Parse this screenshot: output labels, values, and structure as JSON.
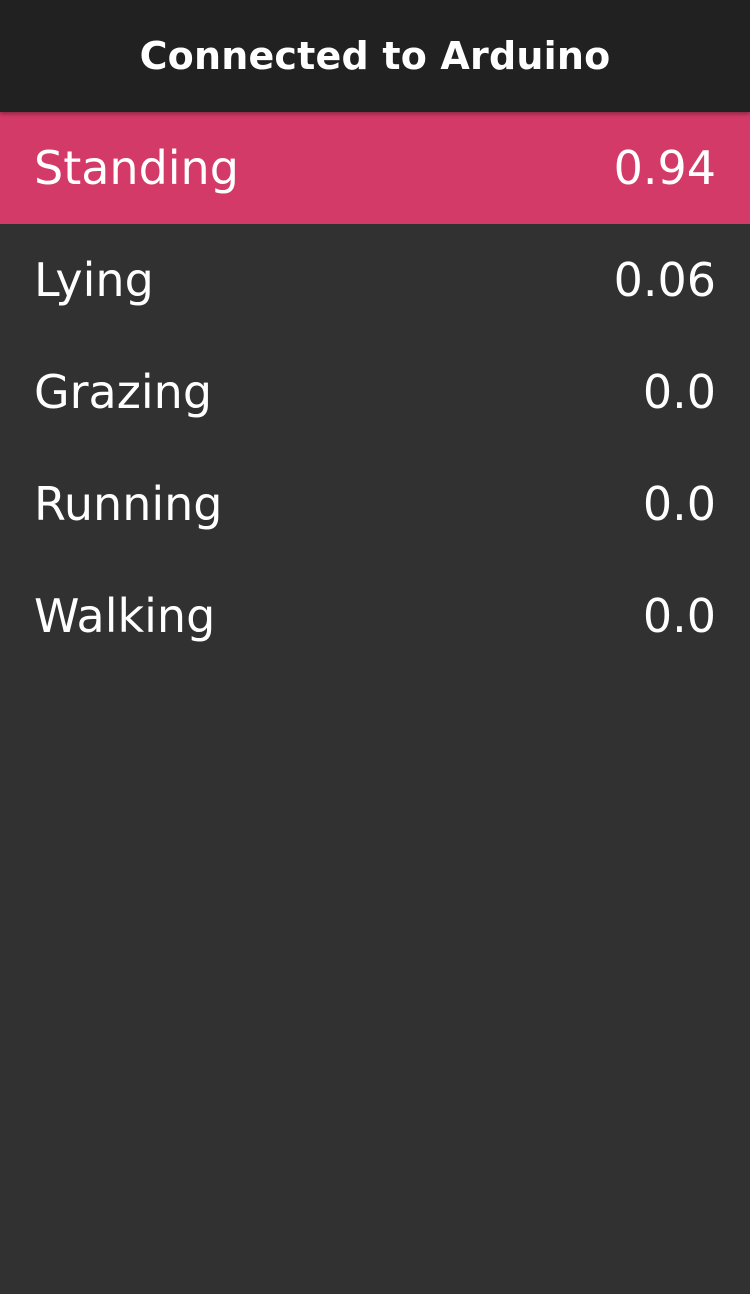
{
  "header": {
    "title": "Connected to Arduino"
  },
  "colors": {
    "header_bg": "#212121",
    "background": "#313131",
    "active_row": "#d43a67",
    "text": "#ffffff"
  },
  "activities": [
    {
      "label": "Standing",
      "value": "0.94",
      "active": true
    },
    {
      "label": "Lying",
      "value": "0.06",
      "active": false
    },
    {
      "label": "Grazing",
      "value": "0.0",
      "active": false
    },
    {
      "label": "Running",
      "value": "0.0",
      "active": false
    },
    {
      "label": "Walking",
      "value": "0.0",
      "active": false
    }
  ]
}
